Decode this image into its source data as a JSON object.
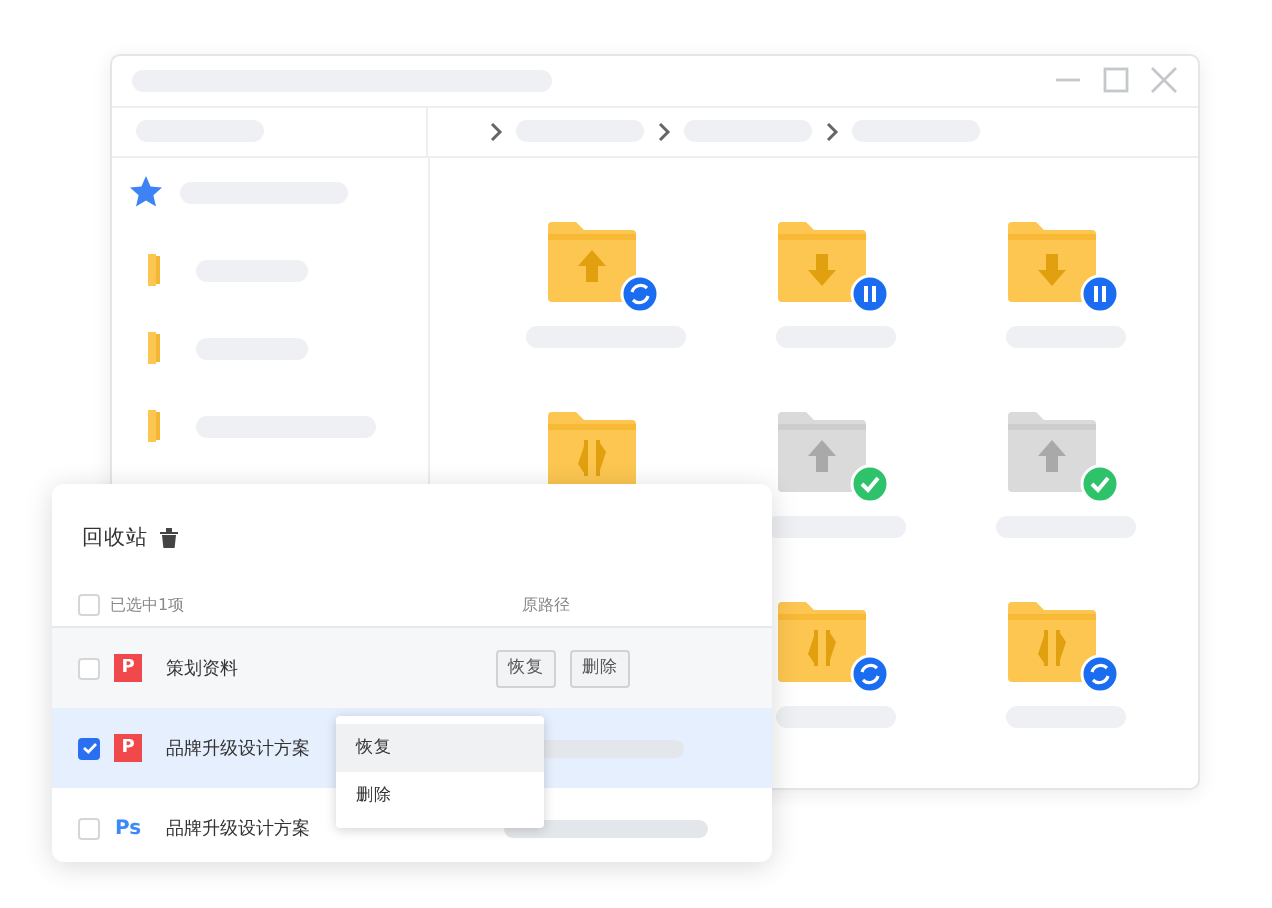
{
  "sidebar": {
    "items": [
      {
        "kind": "star"
      },
      {
        "kind": "folder"
      },
      {
        "kind": "folder"
      },
      {
        "kind": "folder"
      }
    ]
  },
  "folders": [
    {
      "kind": "up",
      "color": "#fcc650",
      "badge": {
        "kind": "sync"
      }
    },
    {
      "kind": "down",
      "color": "#fcc650",
      "badge": {
        "kind": "pause"
      }
    },
    {
      "kind": "down",
      "color": "#fcc650",
      "badge": {
        "kind": "pause"
      }
    },
    {
      "kind": "swap",
      "color": "#fcc650"
    },
    {
      "kind": "up",
      "color": "#dadada",
      "badge": {
        "kind": "done"
      }
    },
    {
      "kind": "up",
      "color": "#dadada",
      "badge": {
        "kind": "done"
      }
    },
    {
      "kind": "swap",
      "color": "#fcc650",
      "badge": {
        "kind": "sync"
      }
    },
    {
      "kind": "swap",
      "color": "#fcc650",
      "badge": {
        "kind": "sync"
      }
    }
  ],
  "recycle": {
    "title": "回收站",
    "select_all": false,
    "selection_label": "已选中1项",
    "path_header": "原路径",
    "rows": [
      {
        "kind": "ppt",
        "badge": "P",
        "name": "策划资料",
        "checked": false,
        "selected": false,
        "buttons": [
          "恢复",
          "删除"
        ]
      },
      {
        "kind": "ppt",
        "badge": "P",
        "name": "品牌升级设计方案",
        "checked": true,
        "selected": true
      },
      {
        "kind": "ps",
        "badge": "Ps",
        "name": "品牌升级设计方案",
        "checked": false,
        "selected": false
      }
    ],
    "context_menu": {
      "items": [
        {
          "label": "恢复",
          "selected": true
        },
        {
          "label": "删除",
          "selected": false
        }
      ]
    }
  }
}
